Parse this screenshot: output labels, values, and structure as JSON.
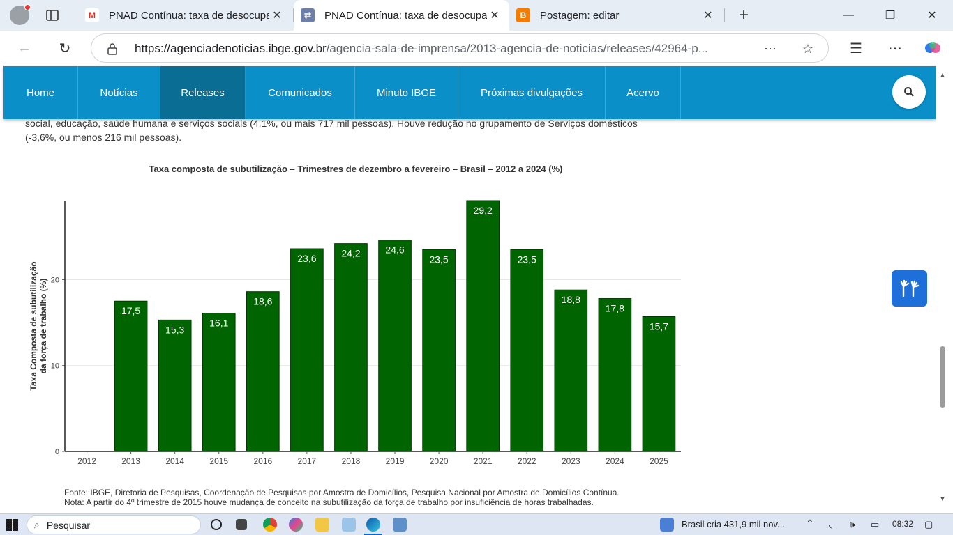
{
  "browser": {
    "tabs": [
      {
        "title": "PNAD Contínua: taxa de desocupação",
        "close": "✕"
      },
      {
        "title": "PNAD Contínua: taxa de desocupação",
        "close": "✕"
      },
      {
        "title": "Postagem: editar",
        "close": "✕"
      }
    ],
    "new_tab": "+",
    "window_controls": {
      "minimize": "—",
      "maximize": "❐",
      "close": "✕"
    },
    "url_host": "https://agenciadenoticias.ibge.gov.br",
    "url_path": "/agencia-sala-de-imprensa/2013-agencia-de-noticias/releases/42964-p..."
  },
  "site_nav": {
    "items": [
      "Home",
      "Notícias",
      "Releases",
      "Comunicados",
      "Minuto IBGE",
      "Próximas divulgações",
      "Acervo"
    ],
    "active": "Releases"
  },
  "article": {
    "paragraph_line1": "social, educação, saúde humana e serviços sociais (4,1%, ou mais 717 mil pessoas). Houve redução no grupamento de Serviços domésticos",
    "paragraph_line2": "(-3,6%, ou menos 216 mil pessoas).",
    "source_note": "Fonte: IBGE, Diretoria de Pesquisas, Coordenação de Pesquisas por Amostra de Domicílios, Pesquisa Nacional por Amostra de Domicílios Contínua.",
    "nota": "Nota: A partir do 4º trimestre de 2015 houve mudança de conceito na subutilização da força de trabalho por insuficiência de horas trabalhadas."
  },
  "chart_data": {
    "type": "bar",
    "title": "Taxa composta de subutilização – Trimestres de dezembro a fevereiro – Brasil – 2012 a 2024 (%)",
    "xlabel": "",
    "ylabel": "Taxa Composta de subutilização da força de trabalho (%)",
    "ylabel_lines": [
      "Taxa Composta de subutilização",
      "da força de trabalho (%)"
    ],
    "categories": [
      "2012",
      "2013",
      "2014",
      "2015",
      "2016",
      "2017",
      "2018",
      "2019",
      "2020",
      "2021",
      "2022",
      "2023",
      "2024",
      "2025"
    ],
    "values": [
      null,
      17.5,
      15.3,
      16.1,
      18.6,
      23.6,
      24.2,
      24.6,
      23.5,
      29.2,
      23.5,
      18.8,
      17.8,
      15.7
    ],
    "labels": [
      "",
      "17,5",
      "15,3",
      "16,1",
      "18,6",
      "23,6",
      "24,2",
      "24,6",
      "23,5",
      "29,2",
      "23,5",
      "18,8",
      "17,8",
      "15,7"
    ],
    "yticks": [
      0,
      10,
      20
    ],
    "ylim": [
      0,
      29.2
    ],
    "bar_color": "#006400",
    "grid": true
  },
  "taskbar": {
    "search_placeholder": "Pesquisar",
    "news": "Brasil cria 431,9 mil nov...",
    "time": "08:32"
  }
}
